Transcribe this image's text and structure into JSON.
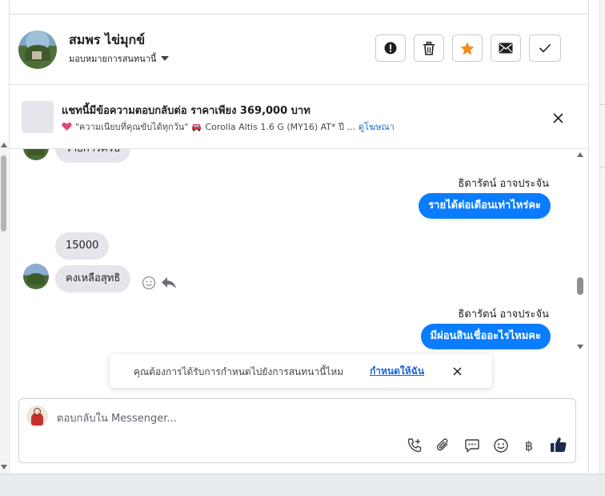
{
  "contact": {
    "name": "สมพร ไข่มุกข์",
    "assign_label": "มอบหมายการสนทนานี้"
  },
  "toolbar": {
    "spam_icon": "alert-circle-icon",
    "delete_icon": "trash-icon",
    "star_icon": "star-icon",
    "unread_icon": "envelope-icon",
    "done_icon": "checkmark-icon",
    "star_color": "#f28b1c"
  },
  "ad": {
    "title": "แชทนี้มีข้อความตอบกลับต่อ ราคาเพียง 369,000 บาท",
    "tagline": "\"ความเนียบที่คุณขับได้ทุกวัน\"",
    "model": "Corolla Altis 1.6 G (MY16) AT* ปี ...",
    "link": "ดูโฆษณา"
  },
  "messages": {
    "partial_top": "รายการครับ",
    "sender_1": "ธิดารัตน์ อาจประจัน",
    "out_1": "รายได้ต่อเดือนเท่าไหร่คะ",
    "in_1": "15000",
    "in_2": "คงเหลือสุทธิ",
    "sender_2": "ธิดารัตน์ อาจประจัน",
    "out_2": "มีผ่อนสินเชื่ออะไรไหมคะ"
  },
  "banner": {
    "text": "คุณต้องการได้รับการกำหนดไปยังการสนทนานี้ไหม",
    "link": "กำหนดให้ฉัน"
  },
  "composer": {
    "placeholder": "ตอบกลับใน Messenger...",
    "icons": [
      "phone-icon",
      "paperclip-icon",
      "saved-reply-icon",
      "emoji-icon",
      "baht-icon",
      "thumbs-up-icon"
    ],
    "currency_symbol": "฿"
  },
  "colors": {
    "outgoing_bubble": "#0a7cff",
    "incoming_bubble": "#e4e6eb",
    "link": "#1a64d6"
  }
}
